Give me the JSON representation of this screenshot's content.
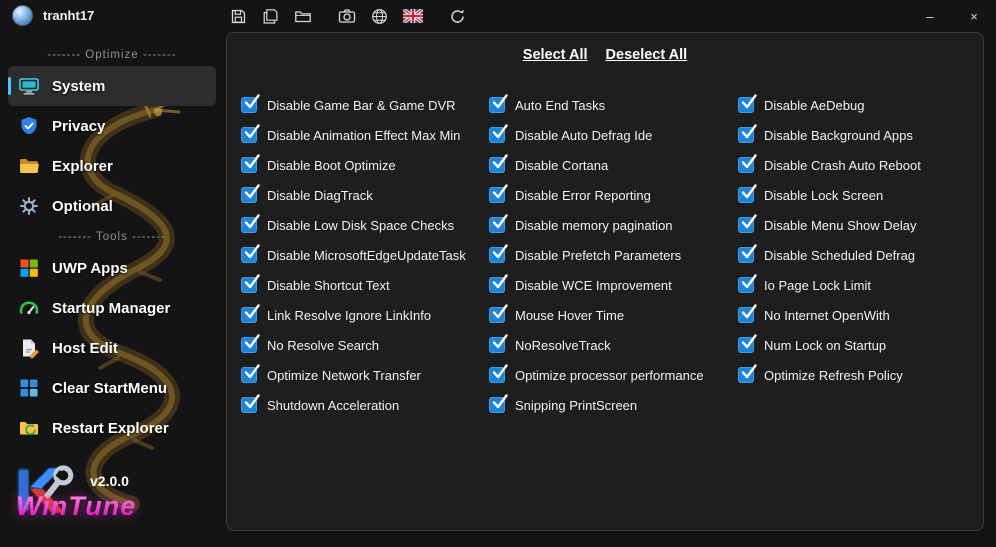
{
  "titlebar": {
    "username": "tranht17",
    "minimize_label": "–",
    "close_label": "×"
  },
  "toolbar": {
    "buttons": [
      {
        "name": "save"
      },
      {
        "name": "save-copy"
      },
      {
        "name": "open-folder"
      },
      {
        "name": "screenshot"
      },
      {
        "name": "network"
      },
      {
        "name": "language-uk-flag"
      },
      {
        "name": "refresh"
      }
    ]
  },
  "sidebar": {
    "entries": [
      {
        "type": "separator",
        "label": "------- Optimize -------"
      },
      {
        "type": "item",
        "label": "System",
        "icon": "system",
        "active": true
      },
      {
        "type": "item",
        "label": "Privacy",
        "icon": "privacy",
        "active": false
      },
      {
        "type": "item",
        "label": "Explorer",
        "icon": "explorer",
        "active": false
      },
      {
        "type": "item",
        "label": "Optional",
        "icon": "optional",
        "active": false
      },
      {
        "type": "separator",
        "label": "------- Tools -------"
      },
      {
        "type": "item",
        "label": "UWP Apps",
        "icon": "uwp-apps",
        "active": false
      },
      {
        "type": "item",
        "label": "Startup Manager",
        "icon": "startup-manager",
        "active": false
      },
      {
        "type": "item",
        "label": "Host Edit",
        "icon": "host-edit",
        "active": false
      },
      {
        "type": "item",
        "label": "Clear StartMenu",
        "icon": "clear-startmenu",
        "active": false
      },
      {
        "type": "item",
        "label": "Restart Explorer",
        "icon": "restart-explorer",
        "active": false
      }
    ],
    "footer": {
      "version": "v2.0.0",
      "brand": "WinTune"
    }
  },
  "main": {
    "select_all_label": "Select All",
    "deselect_all_label": "Deselect All",
    "accent_color": "#1d84d8",
    "columns": [
      {
        "items": [
          {
            "label": "Disable Game Bar & Game DVR",
            "checked": true
          },
          {
            "label": "Disable Animation Effect Max Min",
            "checked": true
          },
          {
            "label": "Disable Boot Optimize",
            "checked": true
          },
          {
            "label": "Disable DiagTrack",
            "checked": true
          },
          {
            "label": "Disable Low Disk Space Checks",
            "checked": true
          },
          {
            "label": "Disable MicrosoftEdgeUpdateTask",
            "checked": true
          },
          {
            "label": "Disable Shortcut Text",
            "checked": true
          },
          {
            "label": "Link Resolve Ignore LinkInfo",
            "checked": true
          },
          {
            "label": "No Resolve Search",
            "checked": true
          },
          {
            "label": "Optimize Network Transfer",
            "checked": true
          },
          {
            "label": "Shutdown Acceleration",
            "checked": true
          }
        ]
      },
      {
        "items": [
          {
            "label": "Auto End Tasks",
            "checked": true
          },
          {
            "label": "Disable Auto Defrag Ide",
            "checked": true
          },
          {
            "label": "Disable Cortana",
            "checked": true
          },
          {
            "label": "Disable Error Reporting",
            "checked": true
          },
          {
            "label": "Disable memory pagination",
            "checked": true
          },
          {
            "label": "Disable Prefetch Parameters",
            "checked": true
          },
          {
            "label": "Disable WCE Improvement",
            "checked": true
          },
          {
            "label": "Mouse Hover Time",
            "checked": true
          },
          {
            "label": "NoResolveTrack",
            "checked": true
          },
          {
            "label": "Optimize processor performance",
            "checked": true
          },
          {
            "label": "Snipping PrintScreen",
            "checked": true
          }
        ]
      },
      {
        "items": [
          {
            "label": "Disable AeDebug",
            "checked": true
          },
          {
            "label": "Disable Background Apps",
            "checked": true
          },
          {
            "label": "Disable Crash Auto Reboot",
            "checked": true
          },
          {
            "label": "Disable Lock Screen",
            "checked": true
          },
          {
            "label": "Disable Menu Show Delay",
            "checked": true
          },
          {
            "label": "Disable Scheduled Defrag",
            "checked": true
          },
          {
            "label": "Io Page Lock Limit",
            "checked": true
          },
          {
            "label": "No Internet OpenWith",
            "checked": true
          },
          {
            "label": "Num Lock on Startup",
            "checked": true
          },
          {
            "label": "Optimize Refresh Policy",
            "checked": true
          }
        ]
      }
    ]
  }
}
